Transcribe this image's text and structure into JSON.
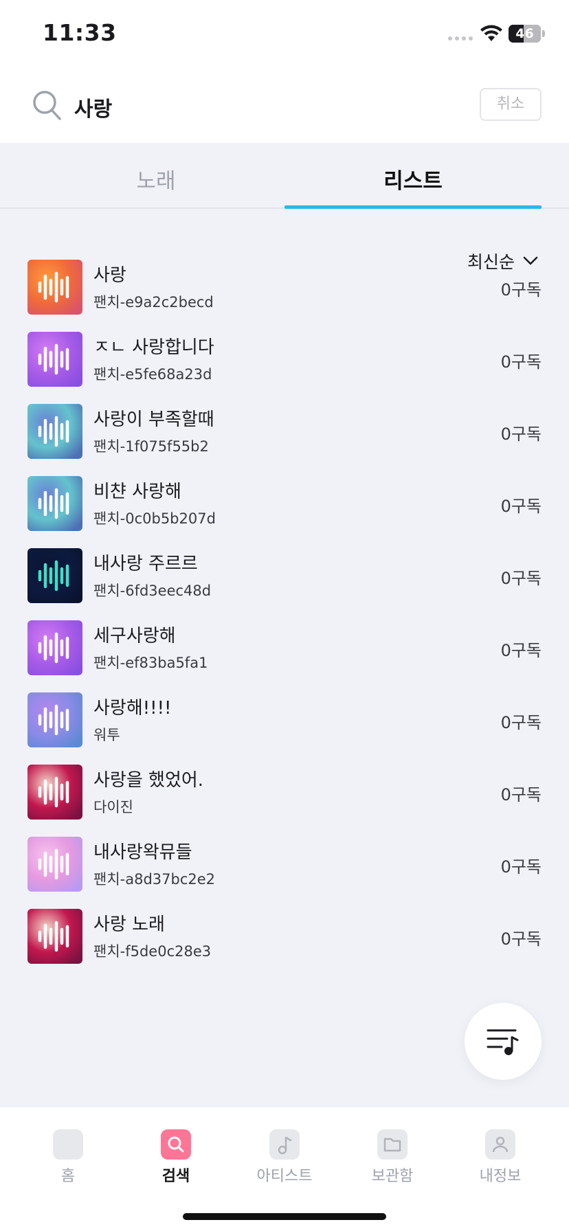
{
  "status_bar": {
    "time": "11:33",
    "battery_level": "46",
    "battery_percent": 46
  },
  "search": {
    "query": "사랑",
    "cancel_label": "취소"
  },
  "tabs": [
    {
      "label": "노래",
      "active": false
    },
    {
      "label": "리스트",
      "active": true
    }
  ],
  "sort": {
    "label": "최신순"
  },
  "results": [
    {
      "title": "사랑",
      "owner": "팬치-e9a2c2becd",
      "subs": "0구독",
      "thumb": "orange"
    },
    {
      "title": "ㅈㄴ 사랑합니다",
      "owner": "팬치-e5fe68a23d",
      "subs": "0구독",
      "thumb": "violet"
    },
    {
      "title": "사랑이 부족할때",
      "owner": "팬치-1f075f55b2",
      "subs": "0구독",
      "thumb": "teal"
    },
    {
      "title": "비챤 사랑해",
      "owner": "팬치-0c0b5b207d",
      "subs": "0구독",
      "thumb": "teal"
    },
    {
      "title": "내사랑 주르르",
      "owner": "팬치-6fd3eec48d",
      "subs": "0구독",
      "thumb": "dark"
    },
    {
      "title": "세구사랑해",
      "owner": "팬치-ef83ba5fa1",
      "subs": "0구독",
      "thumb": "violet"
    },
    {
      "title": "사랑해!!!!",
      "owner": "워투",
      "subs": "0구독",
      "thumb": "blue-violet"
    },
    {
      "title": "사랑을 했었어.",
      "owner": "다이진",
      "subs": "0구독",
      "thumb": "crimson"
    },
    {
      "title": "내사랑왁뮤들",
      "owner": "팬치-a8d37bc2e2",
      "subs": "0구독",
      "thumb": "pink"
    },
    {
      "title": "사랑 노래",
      "owner": "팬치-f5de0c28e3",
      "subs": "0구독",
      "thumb": "crimson"
    }
  ],
  "bottom_nav": [
    {
      "label": "홈",
      "icon": "home-icon",
      "active": false
    },
    {
      "label": "검색",
      "icon": "search-icon",
      "active": true
    },
    {
      "label": "아티스트",
      "icon": "music-note-icon",
      "active": false
    },
    {
      "label": "보관함",
      "icon": "folder-icon",
      "active": false
    },
    {
      "label": "내정보",
      "icon": "profile-icon",
      "active": false
    }
  ],
  "colors": {
    "accent": "#29b8e7",
    "active_nav": "#ff7596",
    "background": "#f1f2f7"
  }
}
